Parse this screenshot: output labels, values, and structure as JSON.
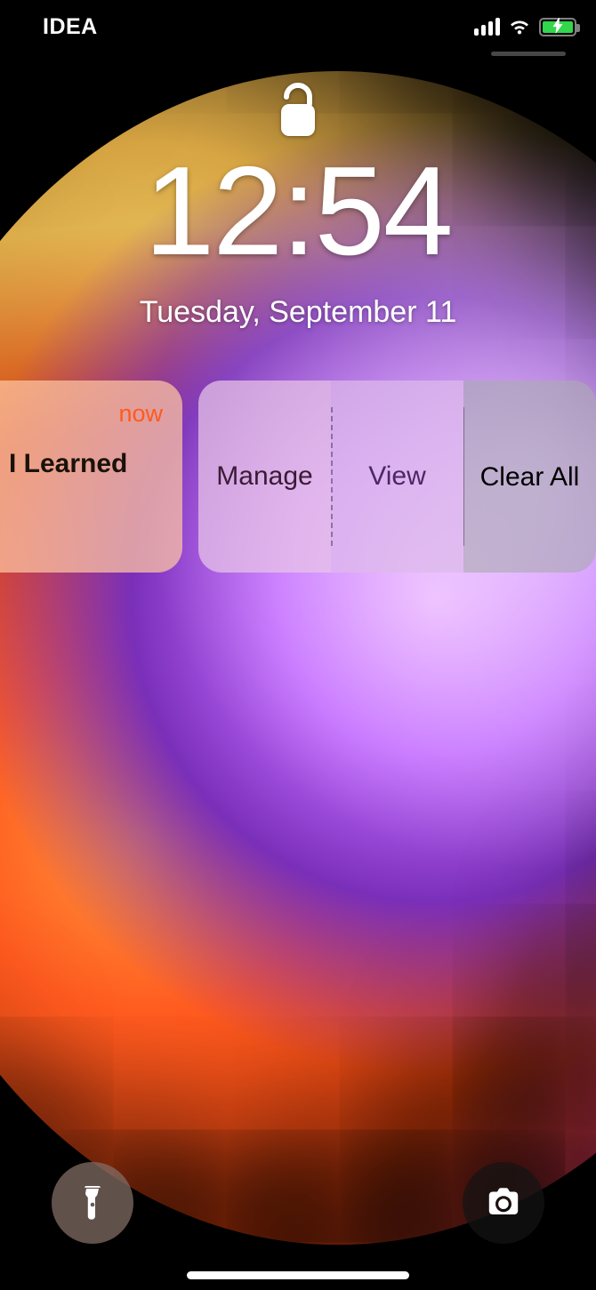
{
  "status": {
    "carrier": "IDEA"
  },
  "lock": {
    "time": "12:54",
    "date": "Tuesday, September 11"
  },
  "notification": {
    "time_label": "now",
    "title_fragment": "I Learned",
    "actions": {
      "manage": "Manage",
      "view": "View",
      "clear": "Clear All"
    }
  }
}
